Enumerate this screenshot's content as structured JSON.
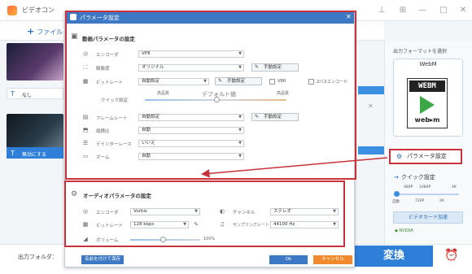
{
  "app": {
    "title": "ビデオコン",
    "add_file": "ファイル",
    "items": [
      {
        "subtitle": "なし"
      },
      {
        "subtitle": "無効にする"
      }
    ],
    "right_panel": {
      "title": "出力フォーマットを選択",
      "format": "WebM",
      "param_button": "パラメータ設定",
      "quick_title": "クイック設定",
      "quick_top": [
        "480P",
        "1080P",
        "4K"
      ],
      "quick_bottom": [
        "自動",
        "720P",
        "2K"
      ],
      "gpu_button": "ビデオカード加速"
    },
    "output_folder_label": "出力フォルダ：",
    "convert_button": "変換"
  },
  "dialog": {
    "title": "パラメータ設定",
    "video": {
      "section_title": "動画パラメータの設定",
      "encoder": {
        "label": "エンコーダ",
        "value": "VP8"
      },
      "resolution": {
        "label": "解像度",
        "value": "オリジナル",
        "button": "手動設定"
      },
      "bitrate": {
        "label": "ビットレート",
        "value": "自動設定",
        "button": "手動設定",
        "vbr": "VBR",
        "two_pass": "2パスエンコード"
      },
      "quick": {
        "label": "クイック設定",
        "left": "高品質",
        "center": "デフォルト値",
        "right": "高品質"
      },
      "framerate": {
        "label": "フレームレート",
        "value": "自動設定",
        "button": "手動設定"
      },
      "aspect": {
        "label": "縦横比",
        "value": "自動"
      },
      "deinterlace": {
        "label": "デインターレース",
        "value": "いいえ"
      },
      "zoom": {
        "label": "ズーム",
        "value": "自動"
      }
    },
    "audio": {
      "section_title": "オーディオパラメータの設定",
      "encoder": {
        "label": "エンコーダ",
        "value": "Vorbis"
      },
      "channel": {
        "label": "チャンネル",
        "value": "ステレオ"
      },
      "bitrate": {
        "label": "ビットレート",
        "value": "128 kbps"
      },
      "samplerate": {
        "label": "サンプリングレート",
        "value": "44100 Hz"
      },
      "volume": {
        "label": "ボリューム",
        "value": "100%"
      }
    },
    "footer": {
      "save_as": "名前を付けて保存",
      "ok": "Ok",
      "cancel": "キャンセル"
    }
  },
  "colors": {
    "accent": "#3d78c4",
    "highlight": "#c8323a",
    "cancel": "#f08a2c"
  }
}
